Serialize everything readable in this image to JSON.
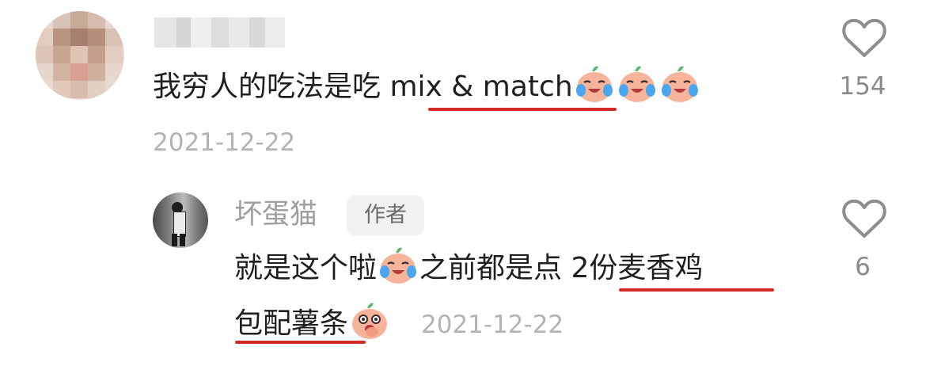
{
  "comment": {
    "author": "",
    "text_before": "我穷人的吃法是吃 ",
    "highlight": "mix & match",
    "emojis": [
      "crying-laughing-peach-emoji",
      "crying-laughing-peach-emoji",
      "crying-laughing-peach-emoji"
    ],
    "date": "2021-12-22",
    "likes": "154"
  },
  "reply": {
    "author": "坏蛋猫",
    "badge": "作者",
    "line1_before": "就是这个啦",
    "line1_mid": "之前都是点 ",
    "line1_highlight": "2份麦香鸡",
    "line2_highlight": "包配薯条",
    "emoji_1": "crying-laughing-peach-emoji",
    "emoji_2": "thinking-peach-emoji",
    "date": "2021-12-22",
    "likes": "6"
  },
  "colors": {
    "highlight_underline": "#d42a2a",
    "text": "#1f1f1f",
    "muted": "#b3b3b3",
    "name": "#9e9e9e"
  }
}
